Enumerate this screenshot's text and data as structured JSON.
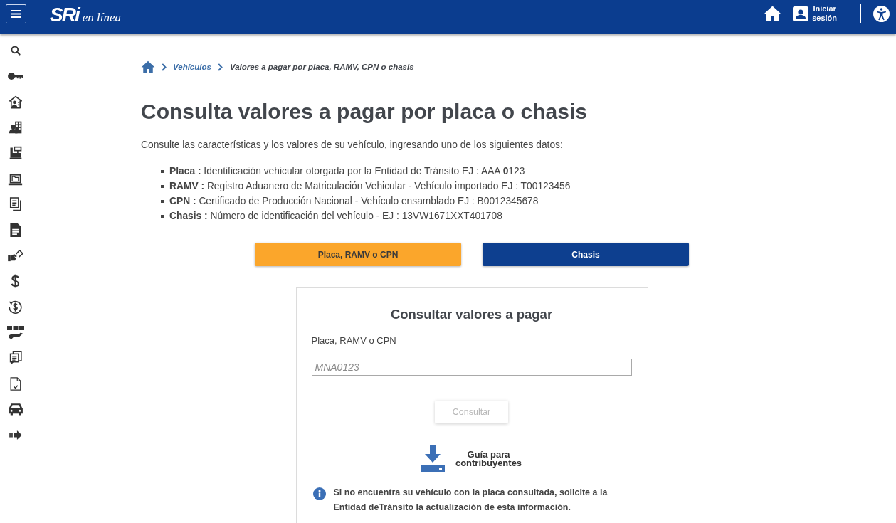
{
  "header": {
    "logo": {
      "mark": "SRi",
      "tagline": "en línea"
    },
    "login_label": "Iniciar sesión"
  },
  "breadcrumb": [
    "Vehículos",
    "Valores a pagar por placa, RAMV, CPN o chasis"
  ],
  "title": "Consulta valores a pagar por placa o chasis",
  "intro": "Consulte las características y los valores de su vehículo, ingresando uno de los siguientes datos:",
  "criteria": [
    "**Placa :** Identificación vehicular otorgada por la Entidad de Tránsito EJ : AAA **0**123",
    "**RAMV :** Registro Aduanero de Matriculación Vehicular - Vehículo importado EJ : T00123456",
    "**CPN :** Certificado de Producción Nacional - Vehículo ensamblado EJ : B0012345678",
    "**Chasis :** Número de identificación del vehículo - EJ : 13VW1671XXT401708"
  ],
  "tabs": [
    {
      "label": "Placa, RAMV o CPN",
      "selected": true
    },
    {
      "label": "Chasis",
      "selected": false
    }
  ],
  "form": {
    "title": "Consultar valores a pagar",
    "field_label": "Placa, RAMV o CPN",
    "placeholder": "MNA0123",
    "submit": {
      "label": "Consultar",
      "disabled": true
    },
    "guide_link": "Guía para contribuyentes",
    "notice": "Si no encuentra su vehículo con la placa consultada, solicite a la Entidad deTránsito la actualización de esta información."
  }
}
